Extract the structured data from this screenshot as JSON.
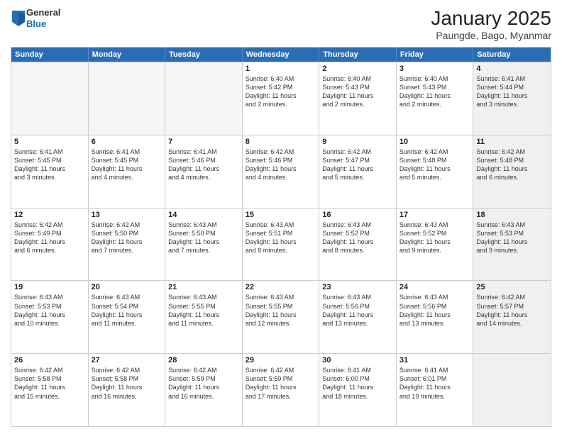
{
  "logo": {
    "general": "General",
    "blue": "Blue"
  },
  "title": "January 2025",
  "subtitle": "Paungde, Bago, Myanmar",
  "weekdays": [
    "Sunday",
    "Monday",
    "Tuesday",
    "Wednesday",
    "Thursday",
    "Friday",
    "Saturday"
  ],
  "rows": [
    [
      {
        "day": "",
        "empty": true
      },
      {
        "day": "",
        "empty": true
      },
      {
        "day": "",
        "empty": true
      },
      {
        "day": "1",
        "lines": [
          "Sunrise: 6:40 AM",
          "Sunset: 5:42 PM",
          "Daylight: 11 hours",
          "and 2 minutes."
        ]
      },
      {
        "day": "2",
        "lines": [
          "Sunrise: 6:40 AM",
          "Sunset: 5:43 PM",
          "Daylight: 11 hours",
          "and 2 minutes."
        ]
      },
      {
        "day": "3",
        "lines": [
          "Sunrise: 6:40 AM",
          "Sunset: 5:43 PM",
          "Daylight: 11 hours",
          "and 2 minutes."
        ]
      },
      {
        "day": "4",
        "lines": [
          "Sunrise: 6:41 AM",
          "Sunset: 5:44 PM",
          "Daylight: 11 hours",
          "and 3 minutes."
        ],
        "shaded": true
      }
    ],
    [
      {
        "day": "5",
        "lines": [
          "Sunrise: 6:41 AM",
          "Sunset: 5:45 PM",
          "Daylight: 11 hours",
          "and 3 minutes."
        ]
      },
      {
        "day": "6",
        "lines": [
          "Sunrise: 6:41 AM",
          "Sunset: 5:45 PM",
          "Daylight: 11 hours",
          "and 4 minutes."
        ]
      },
      {
        "day": "7",
        "lines": [
          "Sunrise: 6:41 AM",
          "Sunset: 5:46 PM",
          "Daylight: 11 hours",
          "and 4 minutes."
        ]
      },
      {
        "day": "8",
        "lines": [
          "Sunrise: 6:42 AM",
          "Sunset: 5:46 PM",
          "Daylight: 11 hours",
          "and 4 minutes."
        ]
      },
      {
        "day": "9",
        "lines": [
          "Sunrise: 6:42 AM",
          "Sunset: 5:47 PM",
          "Daylight: 11 hours",
          "and 5 minutes."
        ]
      },
      {
        "day": "10",
        "lines": [
          "Sunrise: 6:42 AM",
          "Sunset: 5:48 PM",
          "Daylight: 11 hours",
          "and 5 minutes."
        ]
      },
      {
        "day": "11",
        "lines": [
          "Sunrise: 6:42 AM",
          "Sunset: 5:48 PM",
          "Daylight: 11 hours",
          "and 6 minutes."
        ],
        "shaded": true
      }
    ],
    [
      {
        "day": "12",
        "lines": [
          "Sunrise: 6:42 AM",
          "Sunset: 5:49 PM",
          "Daylight: 11 hours",
          "and 6 minutes."
        ]
      },
      {
        "day": "13",
        "lines": [
          "Sunrise: 6:42 AM",
          "Sunset: 5:50 PM",
          "Daylight: 11 hours",
          "and 7 minutes."
        ]
      },
      {
        "day": "14",
        "lines": [
          "Sunrise: 6:43 AM",
          "Sunset: 5:50 PM",
          "Daylight: 11 hours",
          "and 7 minutes."
        ]
      },
      {
        "day": "15",
        "lines": [
          "Sunrise: 6:43 AM",
          "Sunset: 5:51 PM",
          "Daylight: 11 hours",
          "and 8 minutes."
        ]
      },
      {
        "day": "16",
        "lines": [
          "Sunrise: 6:43 AM",
          "Sunset: 5:52 PM",
          "Daylight: 11 hours",
          "and 8 minutes."
        ]
      },
      {
        "day": "17",
        "lines": [
          "Sunrise: 6:43 AM",
          "Sunset: 5:52 PM",
          "Daylight: 11 hours",
          "and 9 minutes."
        ]
      },
      {
        "day": "18",
        "lines": [
          "Sunrise: 6:43 AM",
          "Sunset: 5:53 PM",
          "Daylight: 11 hours",
          "and 9 minutes."
        ],
        "shaded": true
      }
    ],
    [
      {
        "day": "19",
        "lines": [
          "Sunrise: 6:43 AM",
          "Sunset: 5:53 PM",
          "Daylight: 11 hours",
          "and 10 minutes."
        ]
      },
      {
        "day": "20",
        "lines": [
          "Sunrise: 6:43 AM",
          "Sunset: 5:54 PM",
          "Daylight: 11 hours",
          "and 11 minutes."
        ]
      },
      {
        "day": "21",
        "lines": [
          "Sunrise: 6:43 AM",
          "Sunset: 5:55 PM",
          "Daylight: 11 hours",
          "and 11 minutes."
        ]
      },
      {
        "day": "22",
        "lines": [
          "Sunrise: 6:43 AM",
          "Sunset: 5:55 PM",
          "Daylight: 11 hours",
          "and 12 minutes."
        ]
      },
      {
        "day": "23",
        "lines": [
          "Sunrise: 6:43 AM",
          "Sunset: 5:56 PM",
          "Daylight: 11 hours",
          "and 13 minutes."
        ]
      },
      {
        "day": "24",
        "lines": [
          "Sunrise: 6:43 AM",
          "Sunset: 5:56 PM",
          "Daylight: 11 hours",
          "and 13 minutes."
        ]
      },
      {
        "day": "25",
        "lines": [
          "Sunrise: 6:42 AM",
          "Sunset: 5:57 PM",
          "Daylight: 11 hours",
          "and 14 minutes."
        ],
        "shaded": true
      }
    ],
    [
      {
        "day": "26",
        "lines": [
          "Sunrise: 6:42 AM",
          "Sunset: 5:58 PM",
          "Daylight: 11 hours",
          "and 15 minutes."
        ]
      },
      {
        "day": "27",
        "lines": [
          "Sunrise: 6:42 AM",
          "Sunset: 5:58 PM",
          "Daylight: 11 hours",
          "and 16 minutes."
        ]
      },
      {
        "day": "28",
        "lines": [
          "Sunrise: 6:42 AM",
          "Sunset: 5:59 PM",
          "Daylight: 11 hours",
          "and 16 minutes."
        ]
      },
      {
        "day": "29",
        "lines": [
          "Sunrise: 6:42 AM",
          "Sunset: 5:59 PM",
          "Daylight: 11 hours",
          "and 17 minutes."
        ]
      },
      {
        "day": "30",
        "lines": [
          "Sunrise: 6:41 AM",
          "Sunset: 6:00 PM",
          "Daylight: 11 hours",
          "and 18 minutes."
        ]
      },
      {
        "day": "31",
        "lines": [
          "Sunrise: 6:41 AM",
          "Sunset: 6:01 PM",
          "Daylight: 11 hours",
          "and 19 minutes."
        ]
      },
      {
        "day": "",
        "empty": true,
        "shaded": true
      }
    ]
  ]
}
